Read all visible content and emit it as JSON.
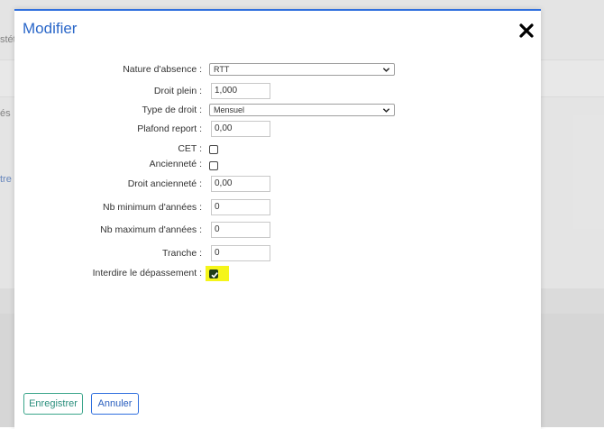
{
  "background": {
    "text_1": "stét",
    "text_2": "és",
    "link_1": "tre"
  },
  "modal": {
    "title": "Modifier",
    "fields": {
      "nature_absence": {
        "label": "Nature d'absence :",
        "value": "RTT"
      },
      "droit_plein": {
        "label": "Droit plein :",
        "value": "1,000"
      },
      "type_droit": {
        "label": "Type de droit :",
        "value": "Mensuel"
      },
      "plafond_report": {
        "label": "Plafond report :",
        "value": "0,00"
      },
      "cet": {
        "label": "CET :",
        "checked": false
      },
      "anciennete": {
        "label": "Ancienneté :",
        "checked": false
      },
      "droit_anciennete": {
        "label": "Droit ancienneté :",
        "value": "0,00"
      },
      "nb_min": {
        "label": "Nb minimum d'années :",
        "value": "0"
      },
      "nb_max": {
        "label": "Nb maximum d'années :",
        "value": "0"
      },
      "tranche": {
        "label": "Tranche :",
        "value": "0"
      },
      "interdire": {
        "label": "Interdire le dépassement :",
        "checked": true
      }
    },
    "buttons": {
      "save": "Enregistrer",
      "cancel": "Annuler"
    }
  },
  "icons": {
    "close": "close-icon",
    "chevron": "chevron-down-icon",
    "check": "checkmark-icon"
  },
  "colors": {
    "accent": "#2f6fde",
    "title": "#2a67c9",
    "save_border": "#3aa58a",
    "highlight": "#f5f51a"
  }
}
